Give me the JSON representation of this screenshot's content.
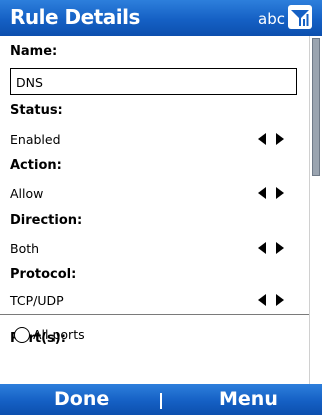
{
  "header": {
    "title": "Rule Details",
    "input_mode": "abc",
    "signal_icon": "signal-strength-icon"
  },
  "form": {
    "name_label": "Name:",
    "name_value": "DNS",
    "status_label": "Status:",
    "status_value": "Enabled",
    "action_label": "Action:",
    "action_value": "Allow",
    "direction_label": "Direction:",
    "direction_value": "Both",
    "protocol_label": "Protocol:",
    "protocol_value": "TCP/UDP",
    "ports_label": "Port(s):",
    "ports_option_all": "All ports"
  },
  "softkeys": {
    "left": "Done",
    "right": "Menu"
  },
  "colors": {
    "bar_blue": "#1560c4",
    "text": "#000000",
    "background": "#ffffff"
  }
}
